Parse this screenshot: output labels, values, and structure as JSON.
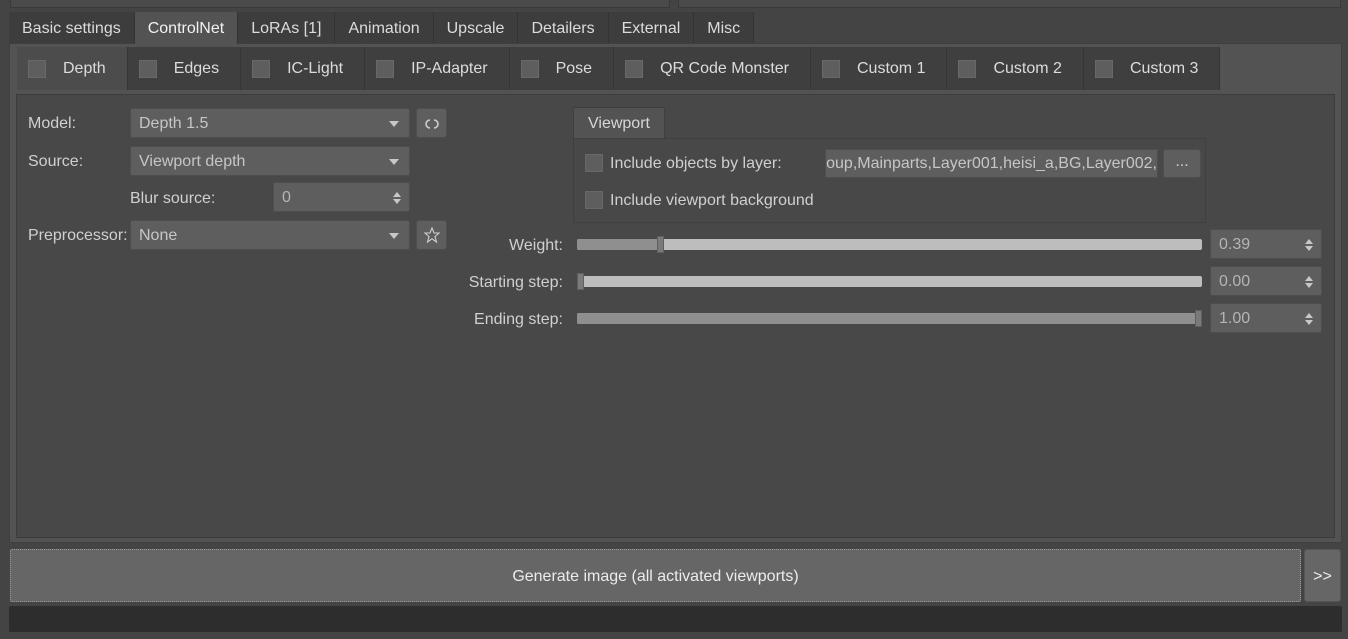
{
  "main_tabs": [
    "Basic settings",
    "ControlNet",
    "LoRAs [1]",
    "Animation",
    "Upscale",
    "Detailers",
    "External",
    "Misc"
  ],
  "main_tabs_active": "ControlNet",
  "sub_tabs": [
    "Depth",
    "Edges",
    "IC-Light",
    "IP-Adapter",
    "Pose",
    "QR Code Monster",
    "Custom 1",
    "Custom 2",
    "Custom 3"
  ],
  "sub_tabs_active": "Depth",
  "form": {
    "model_label": "Model:",
    "model_value": "Depth 1.5",
    "source_label": "Source:",
    "source_value": "Viewport depth",
    "blur_label": "Blur source:",
    "blur_value": "0",
    "preprocessor_label": "Preprocessor:",
    "preprocessor_value": "None",
    "refresh_icon": "refresh-icon",
    "star_icon": "star-icon"
  },
  "viewport": {
    "tab_label": "Viewport",
    "include_layer_label": "Include objects by layer:",
    "include_layer_value": "oup,Mainparts,Layer001,heisi_a,BG,Layer002,",
    "dots_label": "...",
    "include_background_label": "Include viewport background"
  },
  "sliders": {
    "weight_label": "Weight:",
    "weight_value": "0.39",
    "weight_fraction": 0.13,
    "start_label": "Starting step:",
    "start_value": "0.00",
    "start_fraction": 0.0,
    "end_label": "Ending step:",
    "end_value": "1.00",
    "end_fraction": 1.0
  },
  "footer": {
    "generate_label": "Generate image (all activated viewports)",
    "more_label": ">>"
  }
}
